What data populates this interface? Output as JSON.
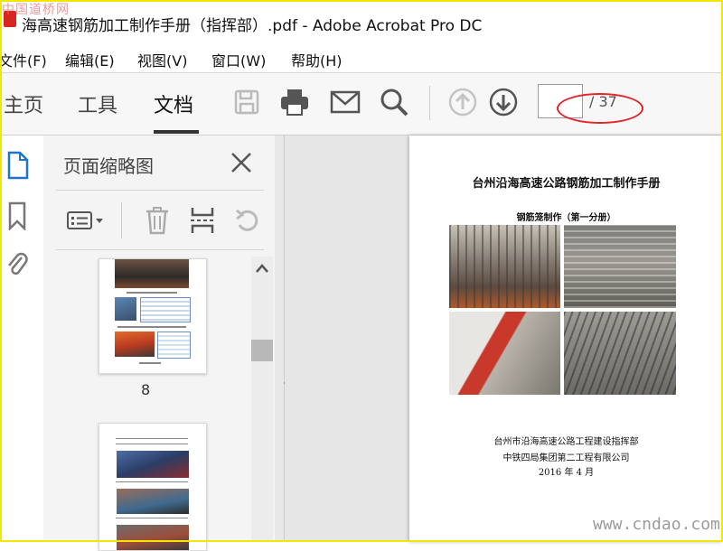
{
  "window": {
    "title": "海高速钢筋加工制作手册（指挥部）.pdf - Adobe Acrobat Pro DC",
    "watermark_top": "中国道桥网"
  },
  "menu": [
    "文件(F)",
    "编辑(E)",
    "视图(V)",
    "窗口(W)",
    "帮助(H)"
  ],
  "toolbar": {
    "tabs": [
      {
        "label": "主页",
        "active": false
      },
      {
        "label": "工具",
        "active": false
      },
      {
        "label": "文档",
        "active": true
      }
    ],
    "icons": [
      "save-icon",
      "print-icon",
      "email-icon",
      "search-icon",
      "page-up-icon",
      "page-down-icon"
    ],
    "page_input_value": "",
    "page_total": "/ 37"
  },
  "sidebar": {
    "icons": [
      "page-thumbnails-icon",
      "bookmark-icon",
      "attachment-icon"
    ],
    "panel_title": "页面缩略图",
    "panel_tools": [
      "options-menu-icon",
      "delete-icon",
      "insert-page-icon",
      "undo-icon"
    ],
    "thumbnails": [
      {
        "page_number": "8"
      },
      {
        "page_number": ""
      }
    ]
  },
  "document": {
    "title": "台州沿海高速公路钢筋加工制作手册",
    "subtitle": "钢筋笼制作（第一分册）",
    "footer_lines": [
      "台州市沿海高速公路工程建设指挥部",
      "中铁四局集团第二工程有限公司",
      "2016 年 4 月"
    ]
  },
  "watermark_bottom": "www.cndao.com",
  "colors": {
    "accent_border": "#f3e600",
    "annotation": "#e5232a",
    "toolbar_bg": "#f7f7f7"
  }
}
